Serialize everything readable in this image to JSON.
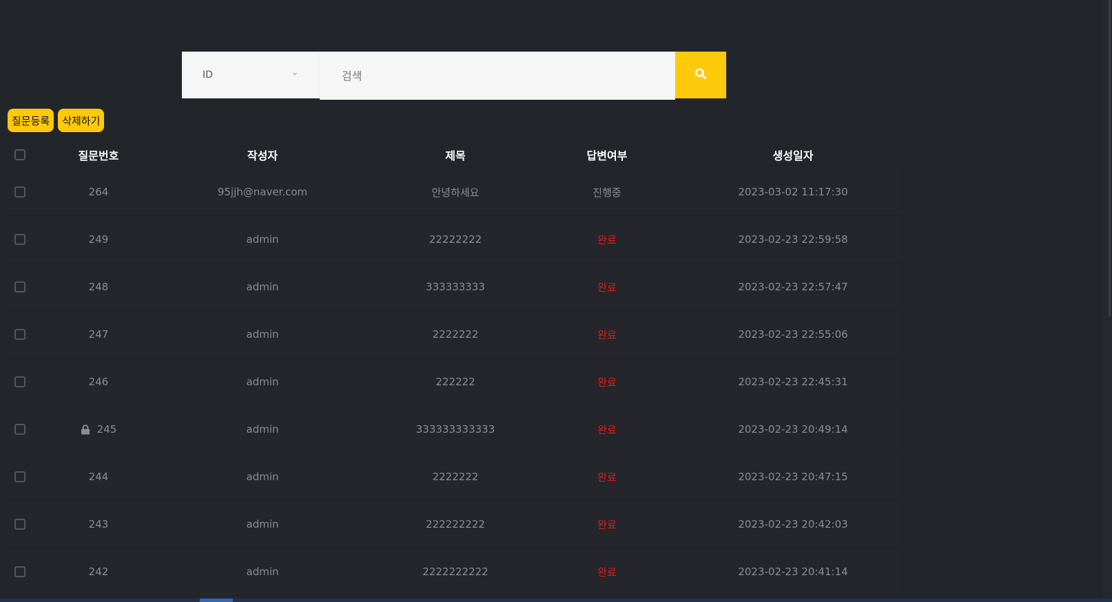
{
  "search": {
    "filter_selected": "ID",
    "placeholder": "검색",
    "value": "",
    "button_icon": "search-icon"
  },
  "actions": {
    "register_label": "질문등록",
    "delete_label": "삭제하기"
  },
  "table": {
    "headers": {
      "number": "질문번호",
      "author": "작성자",
      "title": "제목",
      "answered": "답변여부",
      "created": "생성일자"
    },
    "rows": [
      {
        "number": "264",
        "author": "95jjh@naver.com",
        "title": "안녕하세요",
        "answered": "진행중",
        "created": "2023-03-02 11:17:30",
        "locked": false
      },
      {
        "number": "249",
        "author": "admin",
        "title": "22222222",
        "answered": "완료",
        "created": "2023-02-23 22:59:58",
        "locked": false
      },
      {
        "number": "248",
        "author": "admin",
        "title": "333333333",
        "answered": "완료",
        "created": "2023-02-23 22:57:47",
        "locked": false
      },
      {
        "number": "247",
        "author": "admin",
        "title": "2222222",
        "answered": "완료",
        "created": "2023-02-23 22:55:06",
        "locked": false
      },
      {
        "number": "246",
        "author": "admin",
        "title": "222222",
        "answered": "완료",
        "created": "2023-02-23 22:45:31",
        "locked": false
      },
      {
        "number": "245",
        "author": "admin",
        "title": "333333333333",
        "answered": "완료",
        "created": "2023-02-23 20:49:14",
        "locked": true
      },
      {
        "number": "244",
        "author": "admin",
        "title": "2222222",
        "answered": "완료",
        "created": "2023-02-23 20:47:15",
        "locked": false
      },
      {
        "number": "243",
        "author": "admin",
        "title": "222222222",
        "answered": "완료",
        "created": "2023-02-23 20:42:03",
        "locked": false
      },
      {
        "number": "242",
        "author": "admin",
        "title": "2222222222",
        "answered": "완료",
        "created": "2023-02-23 20:41:14",
        "locked": false
      }
    ]
  },
  "colors": {
    "background": "#222529",
    "accent": "#ffc90b",
    "status_done": "#e01b1b",
    "text_muted": "#8b8d93"
  }
}
